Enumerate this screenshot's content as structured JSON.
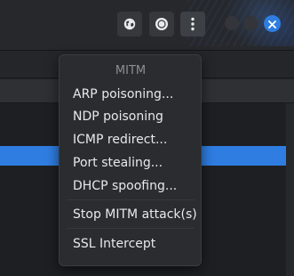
{
  "header": {
    "buttons": [
      {
        "name": "globe-button",
        "icon": "globe-icon"
      },
      {
        "name": "stop-button",
        "icon": "stop-circle-icon"
      },
      {
        "name": "menu-button",
        "icon": "vertical-dots-icon"
      }
    ],
    "window_controls": [
      "minimize-button",
      "maximize-button",
      "close-button"
    ],
    "colors": {
      "accent": "#2f7de1",
      "header_bg": "#26282c",
      "menu_bg": "#2a2c30"
    }
  },
  "menu": {
    "title": "MITM",
    "items": [
      {
        "label": "ARP poisoning..."
      },
      {
        "label": "NDP poisoning"
      },
      {
        "label": "ICMP redirect..."
      },
      {
        "label": "Port stealing..."
      },
      {
        "label": "DHCP spoofing..."
      },
      {
        "label": "Stop MITM attack(s)"
      },
      {
        "label": "SSL Intercept"
      }
    ]
  }
}
